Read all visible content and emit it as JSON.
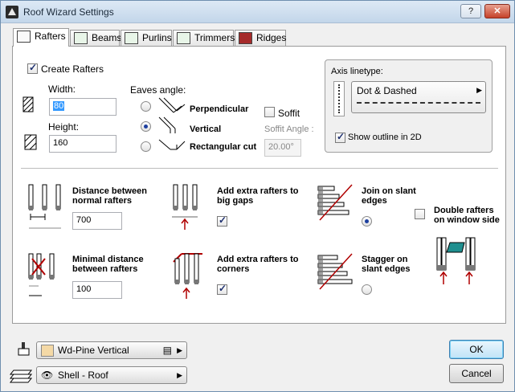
{
  "window": {
    "title": "Roof Wizard Settings",
    "help_label": "?",
    "close_label": "✕"
  },
  "tabs": [
    {
      "label": "Rafters",
      "icon": "rafters-icon",
      "active": true
    },
    {
      "label": "Beams",
      "icon": "beams-icon"
    },
    {
      "label": "Purlins",
      "icon": "purlins-icon"
    },
    {
      "label": "Trimmers",
      "icon": "trimmers-icon"
    },
    {
      "label": "Ridges",
      "icon": "ridges-icon"
    }
  ],
  "rafters": {
    "create_label": "Create Rafters",
    "create_checked": true,
    "width_label": "Width:",
    "width_value": "80",
    "height_label": "Height:",
    "height_value": "160",
    "eaves_label": "Eaves angle:",
    "eaves_options": [
      {
        "label": "Perpendicular",
        "checked": false
      },
      {
        "label": "Vertical",
        "checked": true
      },
      {
        "label": "Rectangular cut",
        "checked": false
      }
    ],
    "soffit_label": "Soffit",
    "soffit_checked": false,
    "soffit_angle_label": "Soffit Angle :",
    "soffit_angle_value": "20.00°"
  },
  "axis": {
    "label": "Axis linetype:",
    "linetype": "Dot & Dashed",
    "show_outline_label": "Show outline in 2D",
    "show_outline_checked": true
  },
  "spacing": {
    "distance_label": "Distance between normal rafters",
    "distance_value": "700",
    "min_distance_label": "Minimal distance between rafters",
    "min_distance_value": "100",
    "extra_gaps_label": "Add extra rafters to big gaps",
    "extra_gaps_checked": true,
    "extra_corners_label": "Add extra rafters to corners",
    "extra_corners_checked": true,
    "join_slant_label": "Join on slant edges",
    "join_slant_checked": true,
    "stagger_slant_label": "Stagger on slant edges",
    "stagger_slant_checked": false,
    "double_window_label": "Double rafters on window side",
    "double_window_checked": false
  },
  "bottom": {
    "material_label": "Wd-Pine Vertical",
    "material_color": "#f4d9a6",
    "layer_label": "Shell - Roof"
  },
  "buttons": {
    "ok_label": "OK",
    "cancel_label": "Cancel"
  },
  "colors": {
    "accent_red": "#b00000",
    "selection_blue": "#3399ff"
  }
}
